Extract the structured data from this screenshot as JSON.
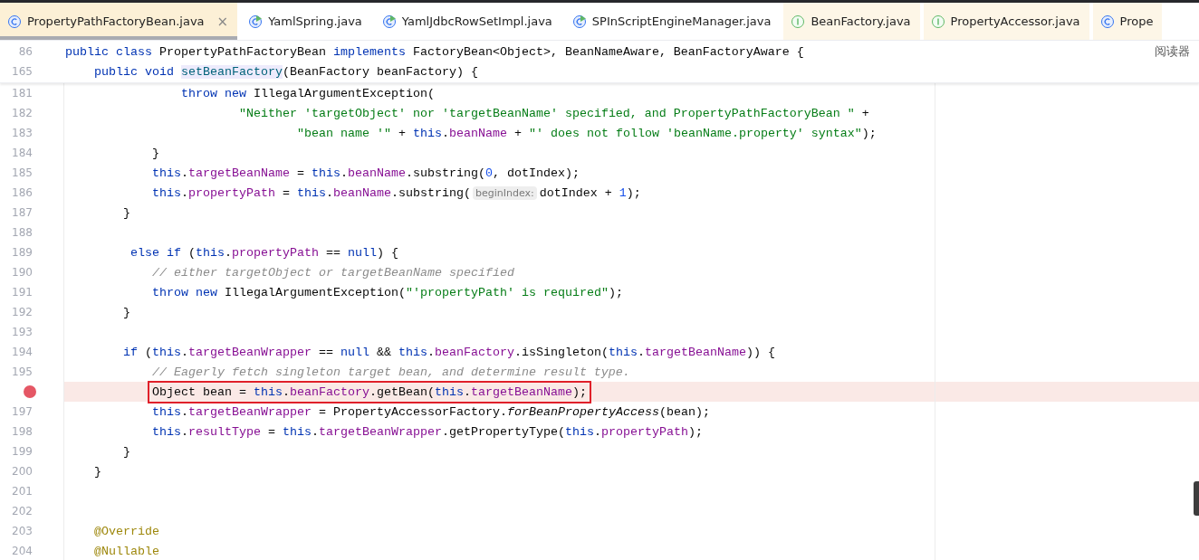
{
  "tabs": [
    {
      "label": "PropertyPathFactoryBean.java",
      "kind": "class",
      "selected": true,
      "tinted": true,
      "closable": true
    },
    {
      "label": "YamlSpring.java",
      "kind": "runnable",
      "selected": false,
      "tinted": false,
      "closable": false
    },
    {
      "label": "YamlJdbcRowSetImpl.java",
      "kind": "runnable",
      "selected": false,
      "tinted": false,
      "closable": false
    },
    {
      "label": "SPInScriptEngineManager.java",
      "kind": "runnable",
      "selected": false,
      "tinted": false,
      "closable": false
    },
    {
      "label": "BeanFactory.java",
      "kind": "interface",
      "selected": false,
      "tinted": true,
      "closable": false
    },
    {
      "label": "PropertyAccessor.java",
      "kind": "interface",
      "selected": false,
      "tinted": true,
      "closable": false
    },
    {
      "label": "Prope",
      "kind": "class",
      "selected": false,
      "tinted": true,
      "closable": false
    }
  ],
  "close_glyph": "×",
  "reader_mode": "阅读器",
  "sticky_lines": [
    {
      "number": "86",
      "tokens": [
        {
          "text": "public class ",
          "kind": "kw"
        },
        {
          "text": "PropertyPathFactoryBean ",
          "kind": "plain"
        },
        {
          "text": "implements ",
          "kind": "kw"
        },
        {
          "text": "FactoryBean<Object>, BeanNameAware, BeanFactoryAware {",
          "kind": "plain"
        }
      ]
    },
    {
      "number": "165",
      "tokens": [
        {
          "text": "    public void ",
          "kind": "kw"
        },
        {
          "text": "setBeanFactory",
          "kind": "decl"
        },
        {
          "text": "(BeanFactory beanFactory) {",
          "kind": "plain"
        }
      ]
    }
  ],
  "lines": [
    {
      "number": "181",
      "breakpoint": false,
      "highlighted": false,
      "boxed": false,
      "tokens": [
        {
          "text": "                throw new ",
          "kind": "kw"
        },
        {
          "text": "IllegalArgumentException(",
          "kind": "plain"
        }
      ]
    },
    {
      "number": "182",
      "breakpoint": false,
      "highlighted": false,
      "boxed": false,
      "tokens": [
        {
          "text": "                        \"Neither 'targetObject' nor 'targetBeanName' specified, and PropertyPathFactoryBean \"",
          "kind": "str"
        },
        {
          "text": " +",
          "kind": "plain"
        }
      ]
    },
    {
      "number": "183",
      "breakpoint": false,
      "highlighted": false,
      "boxed": false,
      "tokens": [
        {
          "text": "                                \"bean name '\"",
          "kind": "str"
        },
        {
          "text": " + ",
          "kind": "plain"
        },
        {
          "text": "this",
          "kind": "kw"
        },
        {
          "text": ".",
          "kind": "plain"
        },
        {
          "text": "beanName",
          "kind": "field"
        },
        {
          "text": " + ",
          "kind": "plain"
        },
        {
          "text": "\"' does not follow 'beanName.property' syntax\"",
          "kind": "str"
        },
        {
          "text": ");",
          "kind": "plain"
        }
      ]
    },
    {
      "number": "184",
      "breakpoint": false,
      "highlighted": false,
      "boxed": false,
      "tokens": [
        {
          "text": "            }",
          "kind": "plain"
        }
      ]
    },
    {
      "number": "185",
      "breakpoint": false,
      "highlighted": false,
      "boxed": false,
      "tokens": [
        {
          "text": "            this",
          "kind": "kw"
        },
        {
          "text": ".",
          "kind": "plain"
        },
        {
          "text": "targetBeanName",
          "kind": "field"
        },
        {
          "text": " = ",
          "kind": "plain"
        },
        {
          "text": "this",
          "kind": "kw"
        },
        {
          "text": ".",
          "kind": "plain"
        },
        {
          "text": "beanName",
          "kind": "field"
        },
        {
          "text": ".substring(",
          "kind": "plain"
        },
        {
          "text": "0",
          "kind": "num"
        },
        {
          "text": ", dotIndex);",
          "kind": "plain"
        }
      ]
    },
    {
      "number": "186",
      "breakpoint": false,
      "highlighted": false,
      "boxed": false,
      "tokens": [
        {
          "text": "            this",
          "kind": "kw"
        },
        {
          "text": ".",
          "kind": "plain"
        },
        {
          "text": "propertyPath",
          "kind": "field"
        },
        {
          "text": " = ",
          "kind": "plain"
        },
        {
          "text": "this",
          "kind": "kw"
        },
        {
          "text": ".",
          "kind": "plain"
        },
        {
          "text": "beanName",
          "kind": "field"
        },
        {
          "text": ".substring(",
          "kind": "plain"
        },
        {
          "text": "beginIndex:",
          "kind": "hint"
        },
        {
          "text": "dotIndex + ",
          "kind": "plain"
        },
        {
          "text": "1",
          "kind": "num"
        },
        {
          "text": ");",
          "kind": "plain"
        }
      ]
    },
    {
      "number": "187",
      "breakpoint": false,
      "highlighted": false,
      "boxed": false,
      "tokens": [
        {
          "text": "        }",
          "kind": "plain"
        }
      ]
    },
    {
      "number": "188",
      "breakpoint": false,
      "highlighted": false,
      "boxed": false
    },
    {
      "number": "189",
      "breakpoint": false,
      "highlighted": false,
      "boxed": false,
      "tokens": [
        {
          "text": "         else if ",
          "kind": "kw"
        },
        {
          "text": "(",
          "kind": "plain"
        },
        {
          "text": "this",
          "kind": "kw"
        },
        {
          "text": ".",
          "kind": "plain"
        },
        {
          "text": "propertyPath",
          "kind": "field"
        },
        {
          "text": " == ",
          "kind": "plain"
        },
        {
          "text": "null",
          "kind": "kw"
        },
        {
          "text": ") {",
          "kind": "plain"
        }
      ]
    },
    {
      "number": "190",
      "breakpoint": false,
      "highlighted": false,
      "boxed": false,
      "tokens": [
        {
          "text": "            // either targetObject or targetBeanName specified",
          "kind": "comment"
        }
      ]
    },
    {
      "number": "191",
      "breakpoint": false,
      "highlighted": false,
      "boxed": false,
      "tokens": [
        {
          "text": "            throw new ",
          "kind": "kw"
        },
        {
          "text": "IllegalArgumentException(",
          "kind": "plain"
        },
        {
          "text": "\"'propertyPath' is required\"",
          "kind": "str"
        },
        {
          "text": ");",
          "kind": "plain"
        }
      ]
    },
    {
      "number": "192",
      "breakpoint": false,
      "highlighted": false,
      "boxed": false,
      "tokens": [
        {
          "text": "        }",
          "kind": "plain"
        }
      ]
    },
    {
      "number": "193",
      "breakpoint": false,
      "highlighted": false,
      "boxed": false
    },
    {
      "number": "194",
      "breakpoint": false,
      "highlighted": false,
      "boxed": false,
      "tokens": [
        {
          "text": "        if ",
          "kind": "kw"
        },
        {
          "text": "(",
          "kind": "plain"
        },
        {
          "text": "this",
          "kind": "kw"
        },
        {
          "text": ".",
          "kind": "plain"
        },
        {
          "text": "targetBeanWrapper",
          "kind": "field"
        },
        {
          "text": " == ",
          "kind": "plain"
        },
        {
          "text": "null",
          "kind": "kw"
        },
        {
          "text": " && ",
          "kind": "plain"
        },
        {
          "text": "this",
          "kind": "kw"
        },
        {
          "text": ".",
          "kind": "plain"
        },
        {
          "text": "beanFactory",
          "kind": "field"
        },
        {
          "text": ".isSingleton(",
          "kind": "plain"
        },
        {
          "text": "this",
          "kind": "kw"
        },
        {
          "text": ".",
          "kind": "plain"
        },
        {
          "text": "targetBeanName",
          "kind": "field"
        },
        {
          "text": ")) {",
          "kind": "plain"
        }
      ]
    },
    {
      "number": "195",
      "breakpoint": false,
      "highlighted": false,
      "boxed": false,
      "tokens": [
        {
          "text": "            // Eagerly fetch singleton target bean, and determine result type.",
          "kind": "comment"
        }
      ]
    },
    {
      "breakpoint": true,
      "highlighted": true,
      "boxed": true,
      "tokens": [
        {
          "text": "            Object bean = ",
          "kind": "plain"
        },
        {
          "text": "this",
          "kind": "kw"
        },
        {
          "text": ".",
          "kind": "plain"
        },
        {
          "text": "beanFactory",
          "kind": "field"
        },
        {
          "text": ".getBean(",
          "kind": "plain"
        },
        {
          "text": "this",
          "kind": "kw"
        },
        {
          "text": ".",
          "kind": "plain"
        },
        {
          "text": "targetBeanName",
          "kind": "field"
        },
        {
          "text": ");",
          "kind": "plain"
        }
      ]
    },
    {
      "number": "197",
      "breakpoint": false,
      "highlighted": false,
      "boxed": false,
      "tokens": [
        {
          "text": "            this",
          "kind": "kw"
        },
        {
          "text": ".",
          "kind": "plain"
        },
        {
          "text": "targetBeanWrapper",
          "kind": "field"
        },
        {
          "text": " = PropertyAccessorFactory.",
          "kind": "plain"
        },
        {
          "text": "forBeanPropertyAccess",
          "kind": "italic"
        },
        {
          "text": "(bean);",
          "kind": "plain"
        }
      ]
    },
    {
      "number": "198",
      "breakpoint": false,
      "highlighted": false,
      "boxed": false,
      "tokens": [
        {
          "text": "            this",
          "kind": "kw"
        },
        {
          "text": ".",
          "kind": "plain"
        },
        {
          "text": "resultType",
          "kind": "field"
        },
        {
          "text": " = ",
          "kind": "plain"
        },
        {
          "text": "this",
          "kind": "kw"
        },
        {
          "text": ".",
          "kind": "plain"
        },
        {
          "text": "targetBeanWrapper",
          "kind": "field"
        },
        {
          "text": ".getPropertyType(",
          "kind": "plain"
        },
        {
          "text": "this",
          "kind": "kw"
        },
        {
          "text": ".",
          "kind": "plain"
        },
        {
          "text": "propertyPath",
          "kind": "field"
        },
        {
          "text": ");",
          "kind": "plain"
        }
      ]
    },
    {
      "number": "199",
      "breakpoint": false,
      "highlighted": false,
      "boxed": false,
      "tokens": [
        {
          "text": "        }",
          "kind": "plain"
        }
      ]
    },
    {
      "number": "200",
      "breakpoint": false,
      "highlighted": false,
      "boxed": false,
      "tokens": [
        {
          "text": "    }",
          "kind": "plain"
        }
      ]
    },
    {
      "number": "201",
      "breakpoint": false,
      "highlighted": false,
      "boxed": false
    },
    {
      "number": "202",
      "breakpoint": false,
      "highlighted": false,
      "boxed": false
    },
    {
      "number": "203",
      "breakpoint": false,
      "highlighted": false,
      "boxed": false,
      "tokens": [
        {
          "text": "    @Override",
          "kind": "annotation"
        }
      ]
    },
    {
      "number": "204",
      "breakpoint": false,
      "highlighted": false,
      "boxed": false,
      "tokens": [
        {
          "text": "    @Nullable",
          "kind": "annotation"
        }
      ]
    }
  ]
}
